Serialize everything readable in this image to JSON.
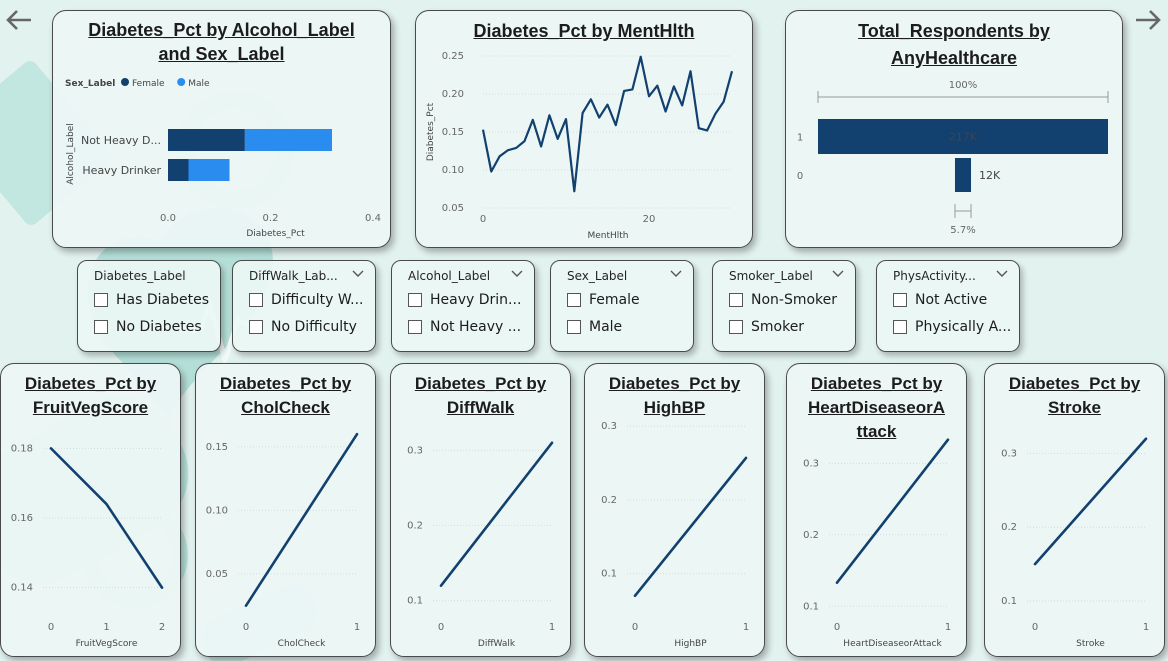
{
  "colors": {
    "dark_navy": "#12406f",
    "bright_blue": "#2b8cf0",
    "line_navy": "#12406f",
    "background": "#e2f2ef"
  },
  "nav": {
    "back_icon": "arrow-left-icon",
    "forward_icon": "arrow-right-icon"
  },
  "alcohol_chart": {
    "title_line1": "Diabetes_Pct by Alcohol_Label",
    "title_line2": "and Sex_Label",
    "legend_title": "Sex_Label",
    "xlabel": "Diabetes_Pct",
    "ylabel": "Alcohol_Label"
  },
  "menthlth_chart": {
    "title": "Diabetes_Pct by MentHlth",
    "xlabel": "MentHlth",
    "ylabel": "Diabetes_Pct"
  },
  "healthcare_chart": {
    "title_line1": "Total_Respondents by",
    "title_line2": "AnyHealthcare"
  },
  "slicers": [
    {
      "title": "Diabetes_Label",
      "options": [
        "Has Diabetes",
        "No Diabetes"
      ]
    },
    {
      "title": "DiffWalk_Lab...",
      "options": [
        "Difficulty W...",
        "No Difficulty"
      ]
    },
    {
      "title": "Alcohol_Label",
      "options": [
        "Heavy Drin...",
        "Not Heavy ..."
      ]
    },
    {
      "title": "Sex_Label",
      "options": [
        "Female",
        "Male"
      ]
    },
    {
      "title": "Smoker_Label",
      "options": [
        "Non-Smoker",
        "Smoker"
      ]
    },
    {
      "title": "PhysActivity...",
      "options": [
        "Not Active",
        "Physically A..."
      ]
    }
  ],
  "small_charts": [
    {
      "title_lines": [
        "Diabetes_Pct by",
        "FruitVegScore"
      ],
      "xlabel": "FruitVegScore"
    },
    {
      "title_lines": [
        "Diabetes_Pct by",
        "CholCheck"
      ],
      "xlabel": "CholCheck"
    },
    {
      "title_lines": [
        "Diabetes_Pct by",
        "DiffWalk"
      ],
      "xlabel": "DiffWalk"
    },
    {
      "title_lines": [
        "Diabetes_Pct by",
        "HighBP"
      ],
      "xlabel": "HighBP"
    },
    {
      "title_lines": [
        "Diabetes_Pct by",
        "HeartDiseaseorA",
        "ttack"
      ],
      "xlabel": "HeartDiseaseorAttack"
    },
    {
      "title_lines": [
        "Diabetes_Pct by",
        "Stroke"
      ],
      "xlabel": "Stroke"
    }
  ],
  "chart_data": [
    {
      "type": "bar",
      "orientation": "horizontal",
      "stacked": true,
      "title": "Diabetes_Pct by Alcohol_Label and Sex_Label",
      "categories": [
        "Not Heavy D...",
        "Heavy Drinker"
      ],
      "series": [
        {
          "name": "Female",
          "color": "#12406f",
          "values": [
            0.15,
            0.04
          ]
        },
        {
          "name": "Male",
          "color": "#2b8cf0",
          "values": [
            0.17,
            0.08
          ]
        }
      ],
      "xlim": [
        0,
        0.4
      ],
      "xticks": [
        "0.0",
        "0.2",
        "0.4"
      ],
      "xlabel": "Diabetes_Pct",
      "ylabel": "Alcohol_Label",
      "legend": "top-left"
    },
    {
      "type": "line",
      "title": "Diabetes_Pct by MentHlth",
      "x": [
        0,
        1,
        2,
        3,
        4,
        5,
        6,
        7,
        8,
        9,
        10,
        11,
        12,
        13,
        14,
        15,
        16,
        17,
        18,
        19,
        20,
        21,
        22,
        23,
        24,
        25,
        26,
        27,
        28,
        29,
        30
      ],
      "y": [
        0.153,
        0.098,
        0.118,
        0.126,
        0.129,
        0.138,
        0.166,
        0.131,
        0.172,
        0.141,
        0.167,
        0.072,
        0.175,
        0.193,
        0.169,
        0.186,
        0.159,
        0.204,
        0.206,
        0.249,
        0.197,
        0.211,
        0.177,
        0.21,
        0.185,
        0.23,
        0.155,
        0.152,
        0.174,
        0.19,
        0.23
      ],
      "xticks": [
        0,
        20
      ],
      "yticks": [
        "0.05",
        "0.10",
        "0.15",
        "0.20",
        "0.25"
      ],
      "ylim": [
        0.05,
        0.25
      ],
      "xlabel": "MentHlth",
      "ylabel": "Diabetes_Pct"
    },
    {
      "type": "bar",
      "orientation": "horizontal",
      "title": "Total_Respondents by AnyHealthcare",
      "categories": [
        "1",
        "0"
      ],
      "values": [
        217000,
        12000
      ],
      "data_labels": [
        "217K",
        "12K"
      ],
      "annotations": [
        "100%",
        "5.7%"
      ]
    },
    {
      "type": "line",
      "title": "Diabetes_Pct by FruitVegScore",
      "x": [
        0,
        1,
        2
      ],
      "y": [
        0.18,
        0.164,
        0.14
      ],
      "xticks": [
        "0",
        "1",
        "2"
      ],
      "yticks": [
        "0.14",
        "0.16",
        "0.18"
      ],
      "ylim": [
        0.133,
        0.187
      ],
      "xlabel": "FruitVegScore"
    },
    {
      "type": "line",
      "title": "Diabetes_Pct by CholCheck",
      "x": [
        0,
        1
      ],
      "y": [
        0.025,
        0.16
      ],
      "xticks": [
        "0",
        "1"
      ],
      "yticks": [
        "0.05",
        "0.10",
        "0.15"
      ],
      "ylim": [
        0.02,
        0.168
      ],
      "xlabel": "CholCheck"
    },
    {
      "type": "line",
      "title": "Diabetes_Pct by DiffWalk",
      "x": [
        0,
        1
      ],
      "y": [
        0.12,
        0.31
      ],
      "xticks": [
        "0",
        "1"
      ],
      "yticks": [
        "0.1",
        "0.2",
        "0.3"
      ],
      "ylim": [
        0.085,
        0.335
      ],
      "xlabel": "DiffWalk"
    },
    {
      "type": "line",
      "title": "Diabetes_Pct by HighBP",
      "x": [
        0,
        1
      ],
      "y": [
        0.07,
        0.257
      ],
      "xticks": [
        "0",
        "1"
      ],
      "yticks": [
        "0.1",
        "0.2",
        "0.3"
      ],
      "ylim": [
        0.048,
        0.303
      ],
      "xlabel": "HighBP"
    },
    {
      "type": "line",
      "title": "Diabetes_Pct by HeartDiseaseorAttack",
      "x": [
        0,
        1
      ],
      "y": [
        0.133,
        0.333
      ],
      "xticks": [
        "0",
        "1"
      ],
      "yticks": [
        "0.1",
        "0.2",
        "0.3"
      ],
      "ylim": [
        0.092,
        0.355
      ],
      "xlabel": "HeartDiseaseorAttack"
    },
    {
      "type": "line",
      "title": "Diabetes_Pct by Stroke",
      "x": [
        0,
        1
      ],
      "y": [
        0.15,
        0.32
      ],
      "xticks": [
        "0",
        "1"
      ],
      "yticks": [
        "0.1",
        "0.2",
        "0.3"
      ],
      "ylim": [
        0.085,
        0.34
      ],
      "xlabel": "Stroke"
    }
  ]
}
